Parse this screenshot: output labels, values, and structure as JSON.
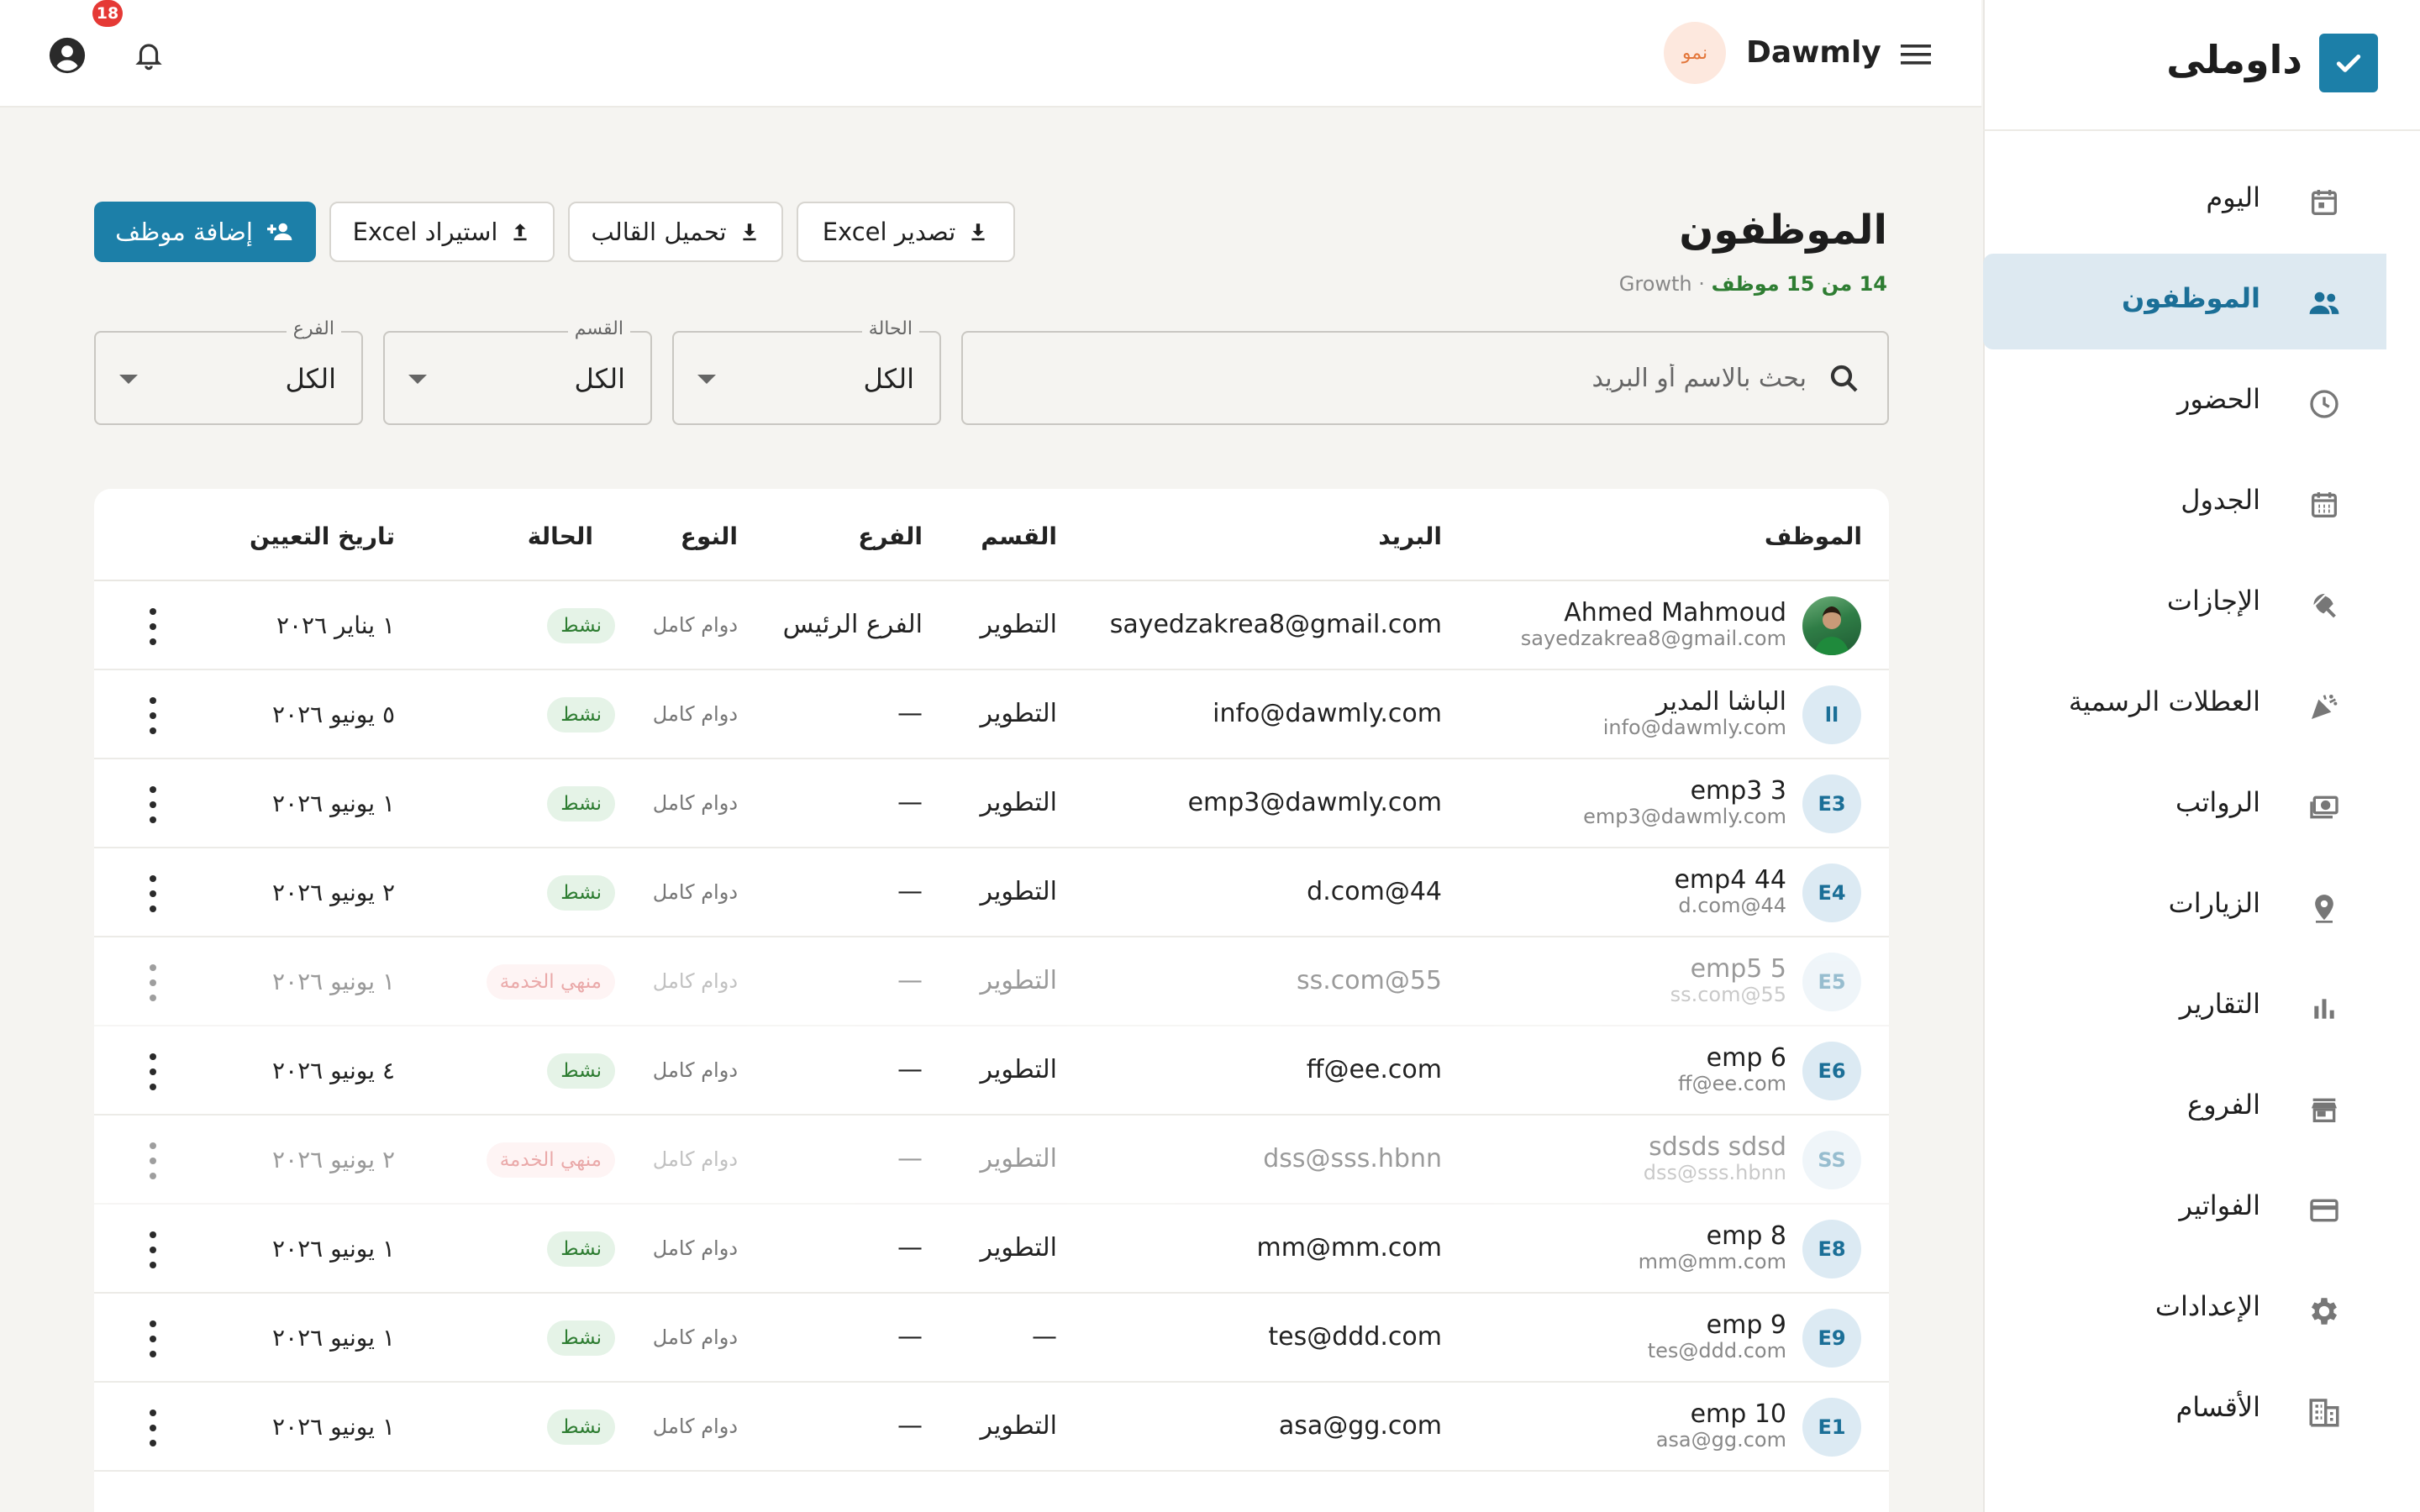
{
  "app": {
    "brand_name": "داوملى",
    "company_name": "Dawmly",
    "plan_badge": "نمو",
    "notifications_count": "18",
    "accent_color": "#1c7fa8"
  },
  "sidebar": {
    "items": [
      {
        "label": "اليوم",
        "icon": "calendar-today-icon",
        "active": false
      },
      {
        "label": "الموظفون",
        "icon": "people-icon",
        "active": true
      },
      {
        "label": "الحضور",
        "icon": "clock-icon",
        "active": false
      },
      {
        "label": "الجدول",
        "icon": "calendar-grid-icon",
        "active": false
      },
      {
        "label": "الإجازات",
        "icon": "beach-umbrella-icon",
        "active": false
      },
      {
        "label": "العطلات الرسمية",
        "icon": "celebration-icon",
        "active": false
      },
      {
        "label": "الرواتب",
        "icon": "payments-icon",
        "active": false
      },
      {
        "label": "الزيارات",
        "icon": "location-pin-icon",
        "active": false
      },
      {
        "label": "التقارير",
        "icon": "bar-chart-icon",
        "active": false
      },
      {
        "label": "الفروع",
        "icon": "store-icon",
        "active": false
      },
      {
        "label": "الفواتير",
        "icon": "credit-card-icon",
        "active": false
      },
      {
        "label": "الإعدادات",
        "icon": "gear-icon",
        "active": false
      },
      {
        "label": "الأقسام",
        "icon": "building-icon",
        "active": false
      }
    ]
  },
  "header": {
    "title": "الموظفون",
    "count_text": "14 من 15 موظف",
    "separator": "·",
    "group": "Growth"
  },
  "toolbar": {
    "export_label": "تصدير Excel",
    "template_label": "تحميل القالب",
    "import_label": "استيراد Excel",
    "add_label": "إضافة موظف"
  },
  "filters": {
    "search_placeholder": "بحث بالاسم أو البريد",
    "status_label": "الحالة",
    "status_value": "الكل",
    "dept_label": "القسم",
    "dept_value": "الكل",
    "branch_label": "الفرع",
    "branch_value": "الكل"
  },
  "table": {
    "headers": {
      "employee": "الموظف",
      "email": "البريد",
      "dept": "القسم",
      "branch": "الفرع",
      "type": "النوع",
      "status": "الحالة",
      "hire_date": "تاريخ التعيين"
    },
    "rows": [
      {
        "initials": "",
        "photo": true,
        "name": "Ahmed Mahmoud",
        "sub": "sayedzakrea8@gmail.com",
        "email": "sayedzakrea8@gmail.com",
        "dept": "التطوير",
        "branch": "الفرع الرئيس",
        "type": "دوام كامل",
        "status": "نشط",
        "status_kind": "active",
        "date": "١ يناير ٢٠٢٦"
      },
      {
        "initials": "اا",
        "photo": false,
        "name": "الباشا المدير",
        "sub": "info@dawmly.com",
        "email": "info@dawmly.com",
        "dept": "التطوير",
        "branch": "—",
        "type": "دوام كامل",
        "status": "نشط",
        "status_kind": "active",
        "date": "٥ يونيو ٢٠٢٦"
      },
      {
        "initials": "E3",
        "photo": false,
        "name": "emp3 3",
        "sub": "emp3@dawmly.com",
        "email": "emp3@dawmly.com",
        "dept": "التطوير",
        "branch": "—",
        "type": "دوام كامل",
        "status": "نشط",
        "status_kind": "active",
        "date": "١ يونيو ٢٠٢٦"
      },
      {
        "initials": "E4",
        "photo": false,
        "name": "emp4 44",
        "sub": "d.com@44",
        "email": "d.com@44",
        "dept": "التطوير",
        "branch": "—",
        "type": "دوام كامل",
        "status": "نشط",
        "status_kind": "active",
        "date": "٢ يونيو ٢٠٢٦"
      },
      {
        "initials": "E5",
        "photo": false,
        "name": "emp5 5",
        "sub": "ss.com@55",
        "email": "ss.com@55",
        "dept": "التطوير",
        "branch": "—",
        "type": "دوام كامل",
        "status": "منهي الخدمة",
        "status_kind": "ended",
        "date": "١ يونيو ٢٠٢٦"
      },
      {
        "initials": "E6",
        "photo": false,
        "name": "emp 6",
        "sub": "ff@ee.com",
        "email": "ff@ee.com",
        "dept": "التطوير",
        "branch": "—",
        "type": "دوام كامل",
        "status": "نشط",
        "status_kind": "active",
        "date": "٤ يونيو ٢٠٢٦"
      },
      {
        "initials": "SS",
        "photo": false,
        "name": "sdsds sdsd",
        "sub": "dss@sss.hbnn",
        "email": "dss@sss.hbnn",
        "dept": "التطوير",
        "branch": "—",
        "type": "دوام كامل",
        "status": "منهي الخدمة",
        "status_kind": "ended",
        "date": "٢ يونيو ٢٠٢٦"
      },
      {
        "initials": "E8",
        "photo": false,
        "name": "emp 8",
        "sub": "mm@mm.com",
        "email": "mm@mm.com",
        "dept": "التطوير",
        "branch": "—",
        "type": "دوام كامل",
        "status": "نشط",
        "status_kind": "active",
        "date": "١ يونيو ٢٠٢٦"
      },
      {
        "initials": "E9",
        "photo": false,
        "name": "emp 9",
        "sub": "tes@ddd.com",
        "email": "tes@ddd.com",
        "dept": "—",
        "branch": "—",
        "type": "دوام كامل",
        "status": "نشط",
        "status_kind": "active",
        "date": "١ يونيو ٢٠٢٦"
      },
      {
        "initials": "E1",
        "photo": false,
        "name": "emp 10",
        "sub": "asa@gg.com",
        "email": "asa@gg.com",
        "dept": "التطوير",
        "branch": "—",
        "type": "دوام كامل",
        "status": "نشط",
        "status_kind": "active",
        "date": "١ يونيو ٢٠٢٦"
      }
    ]
  }
}
